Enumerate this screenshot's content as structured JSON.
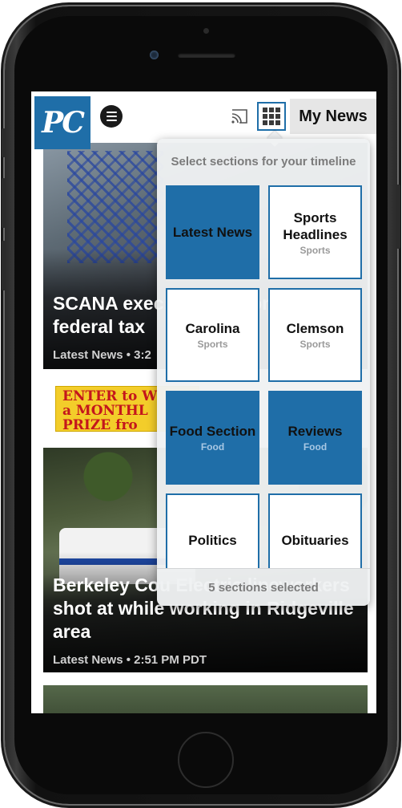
{
  "app": {
    "logo_text": "PC",
    "my_news_label": "My News"
  },
  "icons": {
    "menu": "hamburger-menu-icon",
    "cast": "cast-icon",
    "grid": "grid-icon"
  },
  "colors": {
    "brand_blue": "#1f6ea8",
    "ad_yellow": "#f3cd2a",
    "ad_red": "#c4161c"
  },
  "stories": [
    {
      "headline": "SCANA exec: completion of federal tax",
      "meta": "Latest News • 3:2"
    },
    {
      "headline": "Berkeley Cou Electric lineworkers shot at while working in Ridgeville area",
      "meta": "Latest News • 2:51 PM PDT"
    }
  ],
  "ad": {
    "line1": "ENTER to W",
    "line2": "a MONTHL",
    "line3": "PRIZE fro"
  },
  "sections_panel": {
    "title": "Select sections for your timeline",
    "footer": "5 sections selected",
    "tiles": [
      {
        "name": "Latest News",
        "sub": "",
        "selected": true
      },
      {
        "name": "Sports Headlines",
        "sub": "Sports",
        "selected": false
      },
      {
        "name": "Carolina",
        "sub": "Sports",
        "selected": false
      },
      {
        "name": "Clemson",
        "sub": "Sports",
        "selected": false
      },
      {
        "name": "Food Section",
        "sub": "Food",
        "selected": true
      },
      {
        "name": "Reviews",
        "sub": "Food",
        "selected": true
      },
      {
        "name": "Politics",
        "sub": "",
        "selected": false
      },
      {
        "name": "Obituaries",
        "sub": "",
        "selected": false
      }
    ]
  }
}
